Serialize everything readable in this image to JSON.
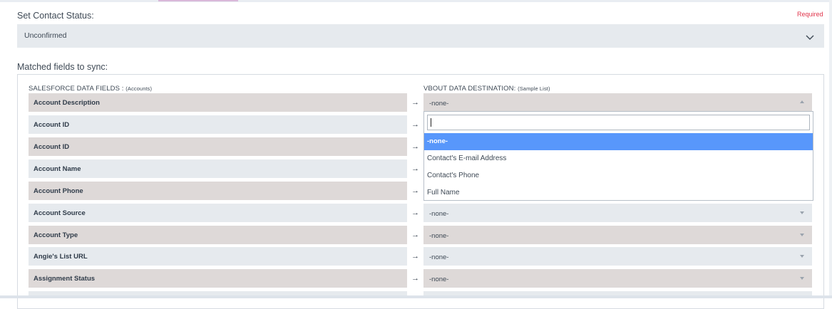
{
  "contact_status": {
    "label": "Set Contact Status:",
    "required_text": "Required",
    "value": "Unconfirmed"
  },
  "matched": {
    "label": "Matched fields to sync:",
    "left_header": "SALESFORCE DATA FIELDS :",
    "left_header_sub": "(Accounts)",
    "right_header": "VBOUT DATA DESTINATION:",
    "right_header_sub": "(Sample List)",
    "arrow_glyph": "→",
    "rows": [
      {
        "field": "Account Description",
        "destination": "-none-"
      },
      {
        "field": "Account ID",
        "destination": ""
      },
      {
        "field": "Account ID",
        "destination": ""
      },
      {
        "field": "Account Name",
        "destination": ""
      },
      {
        "field": "Account Phone",
        "destination": ""
      },
      {
        "field": "Account Source",
        "destination": "-none-"
      },
      {
        "field": "Account Type",
        "destination": "-none-"
      },
      {
        "field": "Angie's List URL",
        "destination": "-none-"
      },
      {
        "field": "Assignment Status",
        "destination": "-none-"
      }
    ]
  },
  "dropdown": {
    "search_value": "",
    "options": [
      "-none-",
      "Contact's E-mail Address",
      "Contact's Phone",
      "Full Name"
    ],
    "selected_index": 0
  },
  "colors": {
    "required": "#e0344b",
    "highlight": "#5897fb",
    "row_dark": "#ded9d8",
    "row_light": "#e6eaee"
  },
  "icons": {
    "status_select": "chevron-down-icon",
    "dest_open": "caret-up-icon",
    "dest_closed": "caret-down-icon",
    "mapping": "arrow-right-icon"
  }
}
